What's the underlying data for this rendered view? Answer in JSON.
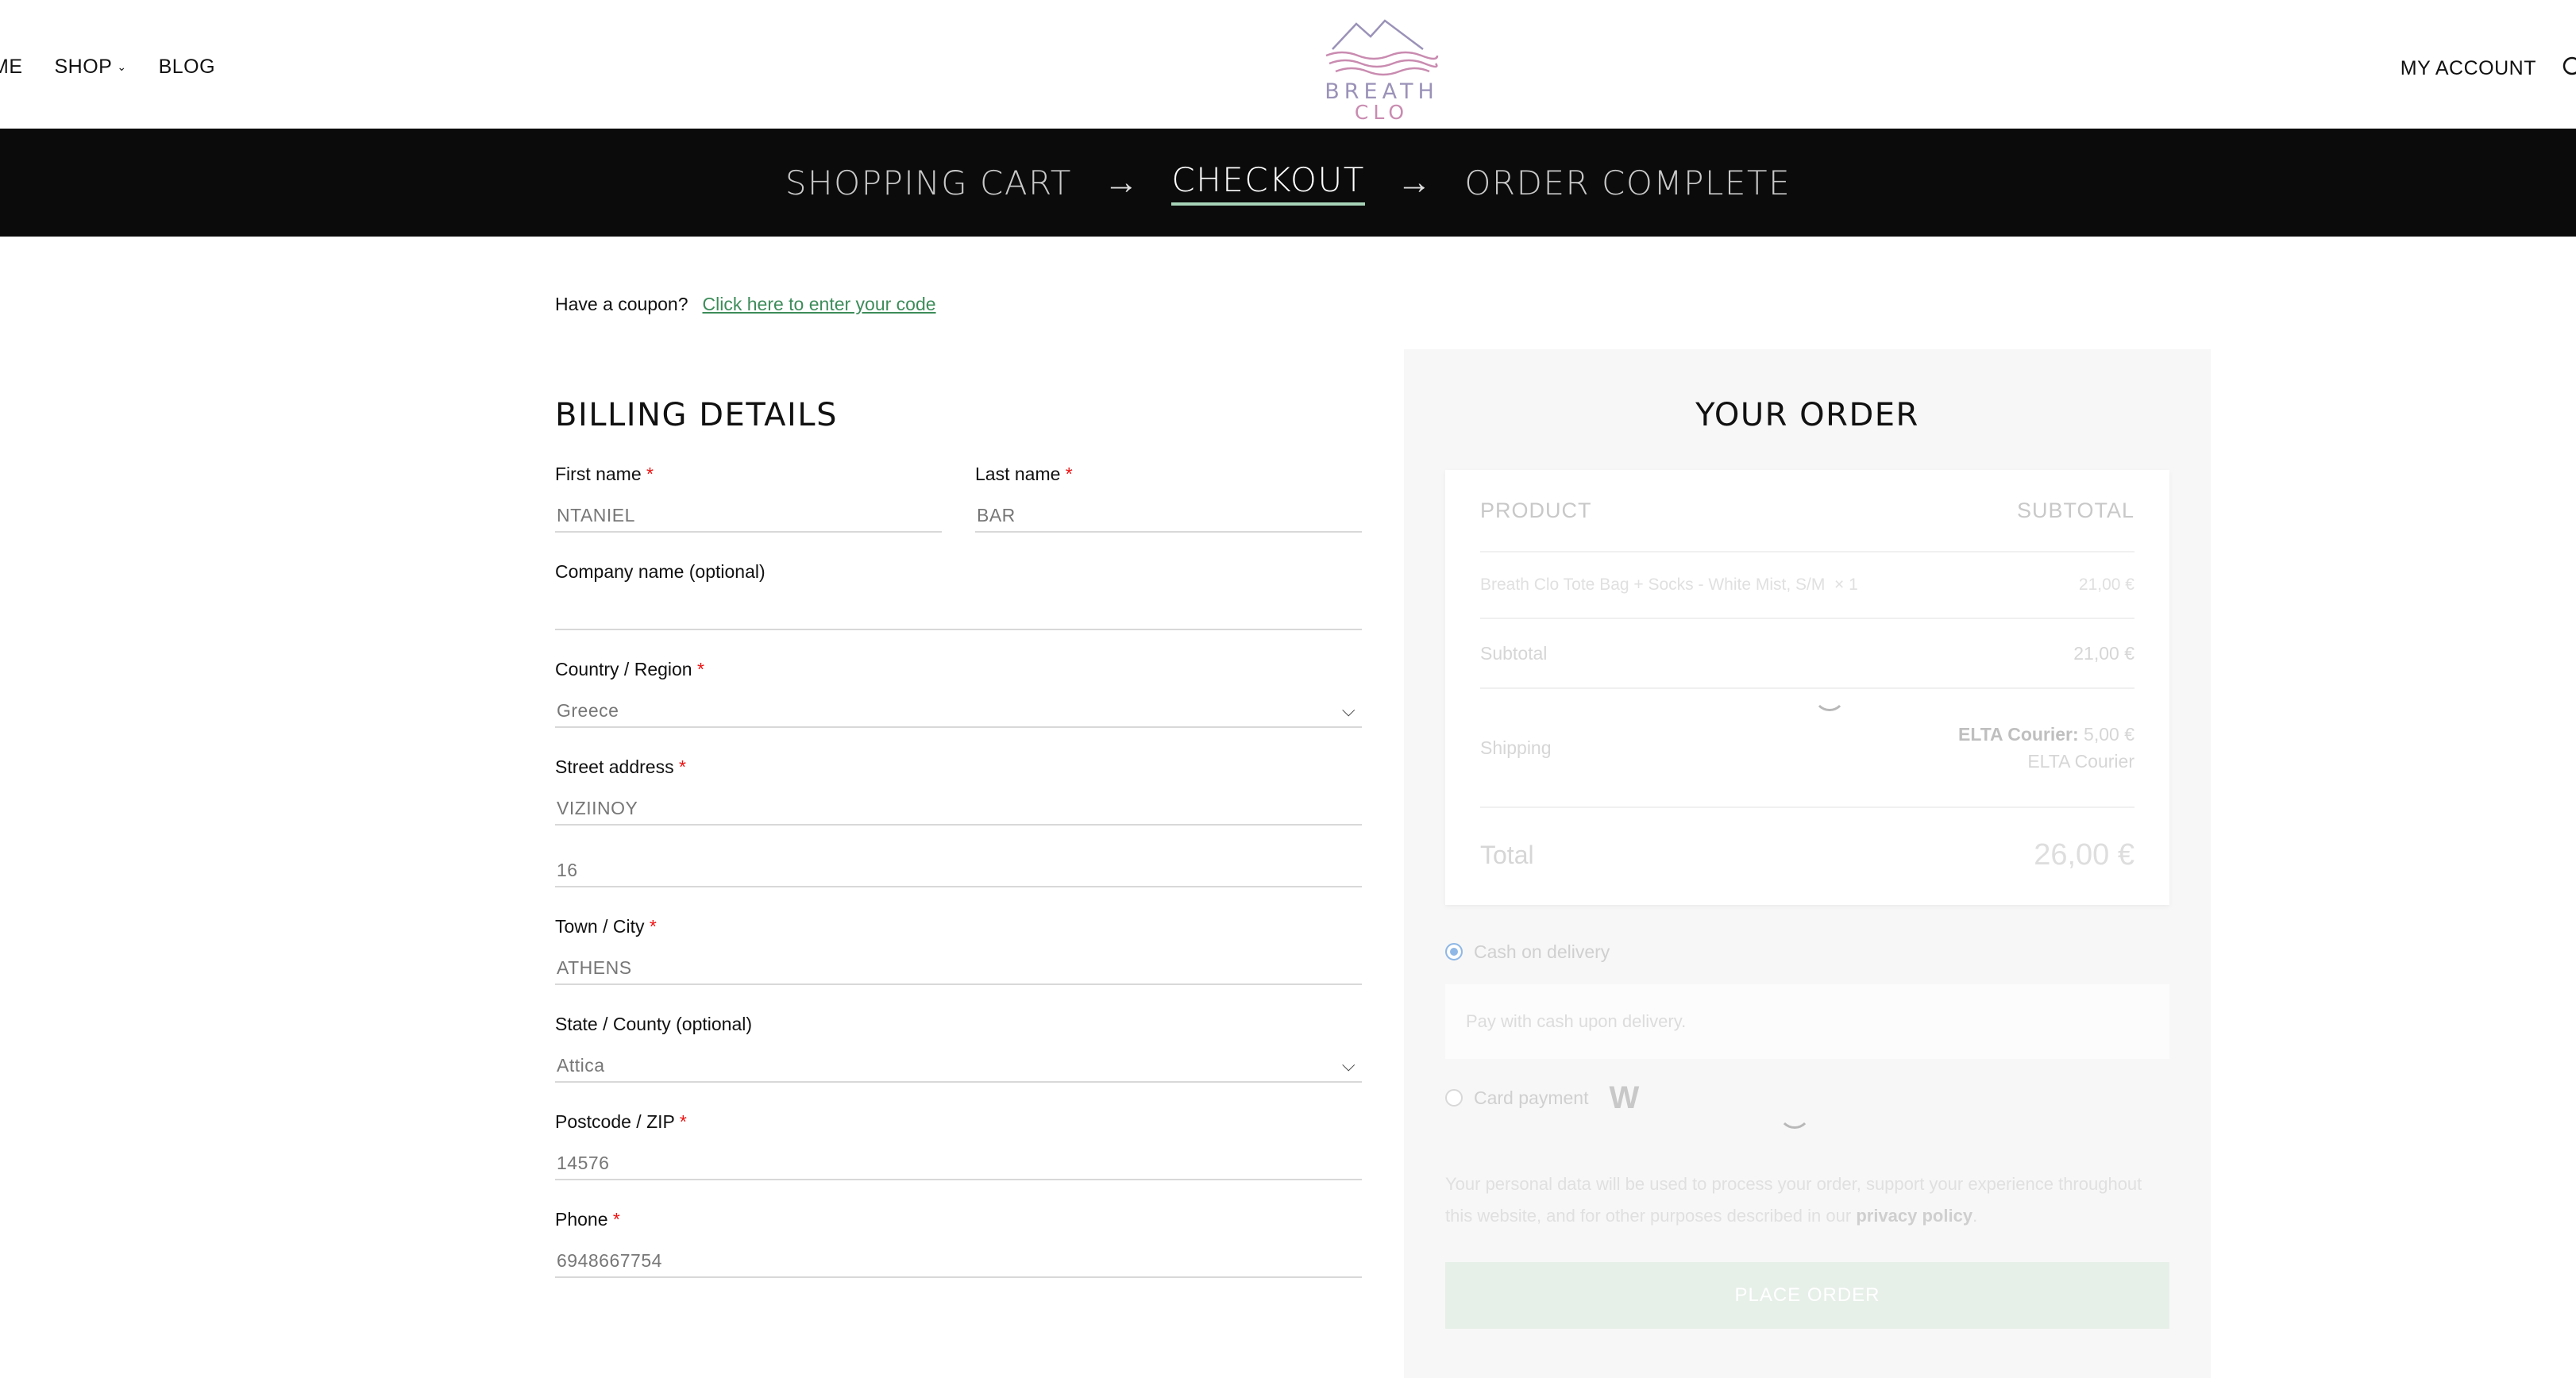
{
  "nav": {
    "home": "ME",
    "shop": "SHOP",
    "blog": "BLOG",
    "account": "MY ACCOUNT"
  },
  "logo": {
    "line1": "BREATH",
    "line2": "CLO"
  },
  "steps": {
    "cart": "SHOPPING CART",
    "checkout": "CHECKOUT",
    "complete": "ORDER COMPLETE",
    "arrow": "→"
  },
  "coupon": {
    "prompt": "Have a coupon?",
    "link": "Click here to enter your code"
  },
  "billing": {
    "title": "BILLING DETAILS",
    "first_name": {
      "label": "First name",
      "value": "NTANIEL"
    },
    "last_name": {
      "label": "Last name",
      "value": "BAR"
    },
    "company": {
      "label": "Company name (optional)",
      "value": ""
    },
    "country": {
      "label": "Country / Region",
      "value": "Greece"
    },
    "street": {
      "label": "Street address",
      "value": "VIZIINOY"
    },
    "street2": {
      "value": "16"
    },
    "town": {
      "label": "Town / City",
      "value": "ATHENS"
    },
    "state": {
      "label": "State / County (optional)",
      "value": "Attica"
    },
    "postcode": {
      "label": "Postcode / ZIP",
      "value": "14576"
    },
    "phone": {
      "label": "Phone",
      "value": "6948667754"
    },
    "required_mark": "*"
  },
  "order": {
    "title": "YOUR ORDER",
    "col_product": "PRODUCT",
    "col_subtotal": "SUBTOTAL",
    "item_name": "Breath Clo Tote Bag + Socks - White Mist, S/M",
    "item_qty": "× 1",
    "item_price": "21,00 €",
    "subtotal_label": "Subtotal",
    "subtotal_value": "21,00 €",
    "shipping_label": "Shipping",
    "shipping_courier": "ELTA Courier:",
    "shipping_price": "5,00 €",
    "shipping_method": "ELTA Courier",
    "total_label": "Total",
    "total_value": "26,00 €"
  },
  "payment": {
    "cod_label": "Cash on delivery",
    "cod_desc": "Pay with cash upon delivery.",
    "card_label": "Card payment",
    "card_logo": "W",
    "privacy_text": "Your personal data will be used to process your order, support your experience throughout this website, and for other purposes described in our",
    "privacy_link": "privacy policy",
    "privacy_end": ".",
    "place_order": "PLACE ORDER"
  },
  "colors": {
    "steps_bg": "#0b0b0b",
    "accent_green": "#3d8c5a",
    "required": "#ee1111"
  }
}
